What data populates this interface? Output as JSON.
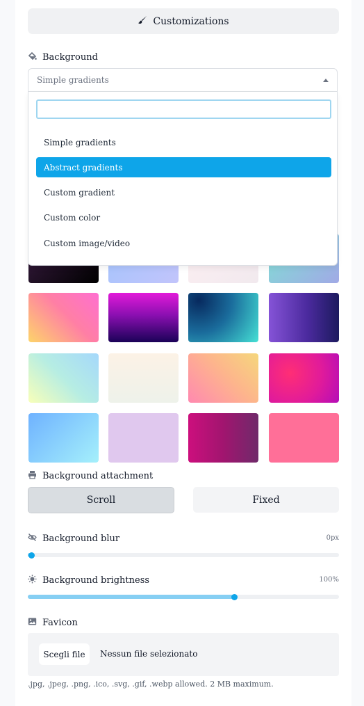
{
  "customizations_label": "Customizations",
  "background": {
    "label": "Background",
    "selected": "Simple gradients",
    "search_value": "",
    "options": [
      "Simple gradients",
      "Abstract gradients",
      "Custom gradient",
      "Custom color",
      "Custom image/video"
    ],
    "highlighted_option": "Abstract gradients"
  },
  "attachment": {
    "label": "Background attachment",
    "options": [
      "Scroll",
      "Fixed"
    ],
    "selected": "Scroll"
  },
  "blur": {
    "label": "Background blur",
    "value_text": "0px",
    "fraction": 0.0
  },
  "brightness": {
    "label": "Background brightness",
    "value_text": "100%",
    "fraction": 0.665
  },
  "favicon": {
    "label": "Favicon",
    "button": "Scegli file",
    "file_status": "Nessun file selezionato",
    "hint": ".jpg, .jpeg, .png, .ico, .svg, .gif, .webp allowed. 2 MB maximum."
  },
  "colors": {
    "accent": "#0ea5e9",
    "accent_light": "#86cff3"
  }
}
